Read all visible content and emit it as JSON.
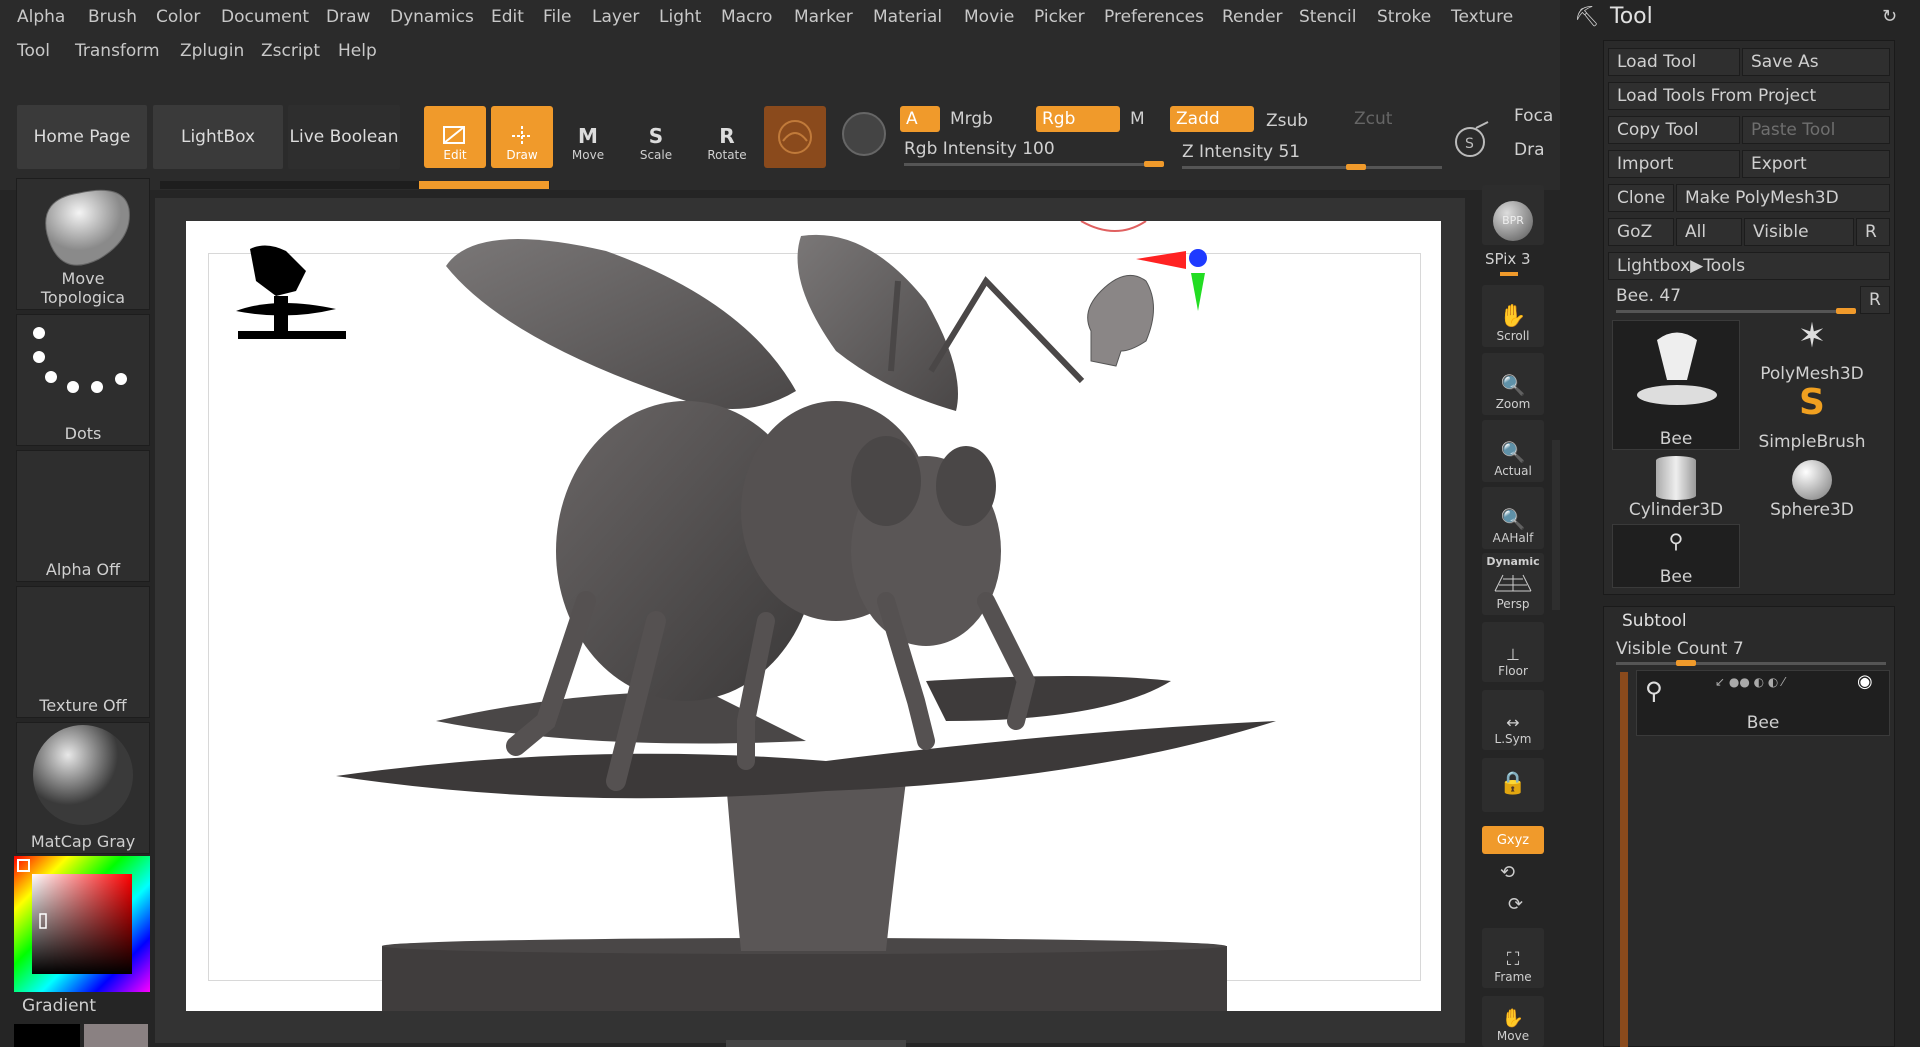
{
  "menu": {
    "row1": [
      "Alpha",
      "Brush",
      "Color",
      "Document",
      "Draw",
      "Dynamics",
      "Edit",
      "File",
      "Layer",
      "Light",
      "Macro",
      "Marker",
      "Material",
      "Movie",
      "Picker",
      "Preferences",
      "Render",
      "Stencil",
      "Stroke",
      "Texture"
    ],
    "row2": [
      "Tool",
      "Transform",
      "Zplugin",
      "Zscript",
      "Help"
    ]
  },
  "toolbar": {
    "home_page": "Home Page",
    "lightbox": "LightBox",
    "live_boolean": "Live Boolean",
    "edit": "Edit",
    "draw": "Draw",
    "move": "Move",
    "scale": "Scale",
    "rotate": "Rotate",
    "a": "A",
    "mrgb": "Mrgb",
    "rgb": "Rgb",
    "m": "M",
    "zadd": "Zadd",
    "zsub": "Zsub",
    "zcut": "Zcut",
    "rgb_intensity": "Rgb Intensity 100",
    "z_intensity": "Z Intensity 51",
    "focal": "Foca",
    "draw_size": "Dra",
    "rgb_intensity_value": 100,
    "z_intensity_value": 51
  },
  "left_shelf": {
    "brush": "Move Topologica",
    "stroke": "Dots",
    "alpha": "Alpha Off",
    "texture": "Texture Off",
    "material": "MatCap Gray",
    "gradient": "Gradient"
  },
  "right_shelf": {
    "bpr": "BPR",
    "spix": "SPix 3",
    "scroll": "Scroll",
    "zoom": "Zoom",
    "actual": "Actual",
    "aahalf": "AAHalf",
    "dynamic": "Dynamic",
    "persp": "Persp",
    "floor": "Floor",
    "lsym": "L.Sym",
    "xyz": "Gxyz",
    "frame": "Frame",
    "move": "Move"
  },
  "tool_panel": {
    "title": "Tool",
    "load_tool": "Load Tool",
    "save_as": "Save As",
    "load_from_project": "Load Tools From Project",
    "copy_tool": "Copy Tool",
    "paste_tool": "Paste Tool",
    "import": "Import",
    "export": "Export",
    "clone": "Clone",
    "make_polymesh": "Make PolyMesh3D",
    "goz": "GoZ",
    "all": "All",
    "visible": "Visible",
    "r": "R",
    "lightbox_tools": "Lightbox▶Tools",
    "current_tool": "Bee. 47",
    "current_tool_r": "R",
    "thumbs": [
      "Bee",
      "PolyMesh3D",
      "SimpleBrush",
      "Cylinder3D",
      "Sphere3D",
      "Bee"
    ],
    "subtool_title": "Subtool",
    "visible_count": "Visible Count 7",
    "subtool_item": "Bee"
  },
  "colors": {
    "accent": "#f09a2b",
    "panel": "#2b2b2b",
    "canvas": "#ffffff"
  }
}
